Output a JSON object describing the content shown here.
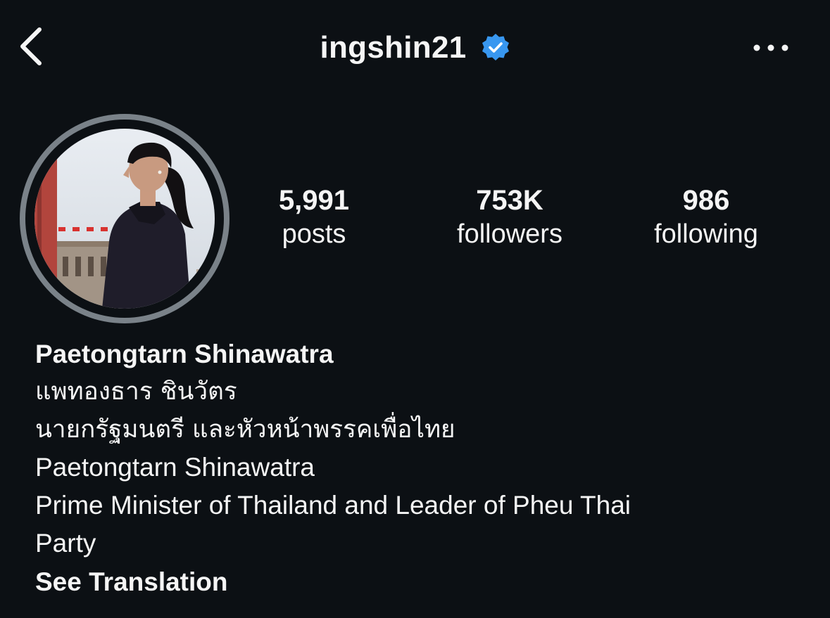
{
  "header": {
    "username": "ingshin21",
    "back_icon": "chevron-left-icon",
    "verified_icon": "verified-badge-icon",
    "more_icon": "more-horizontal-icon"
  },
  "profile": {
    "avatar_icon": "profile-photo"
  },
  "stats": [
    {
      "value": "5,991",
      "label": "posts"
    },
    {
      "value": "753K",
      "label": "followers"
    },
    {
      "value": "986",
      "label": "following"
    }
  ],
  "bio": {
    "name": "Paetongtarn Shinawatra",
    "lines": [
      "แพทองธาร ชินวัตร",
      "นายกรัฐมนตรี และหัวหน้าพรรคเพื่อไทย",
      "Paetongtarn Shinawatra",
      "Prime Minister of Thailand and Leader of Pheu Thai",
      "Party"
    ],
    "see_translation": "See Translation"
  },
  "colors": {
    "background": "#0c1014",
    "text": "#f5f5f5",
    "verified": "#3897f0",
    "avatar_ring": "#7a8289"
  }
}
